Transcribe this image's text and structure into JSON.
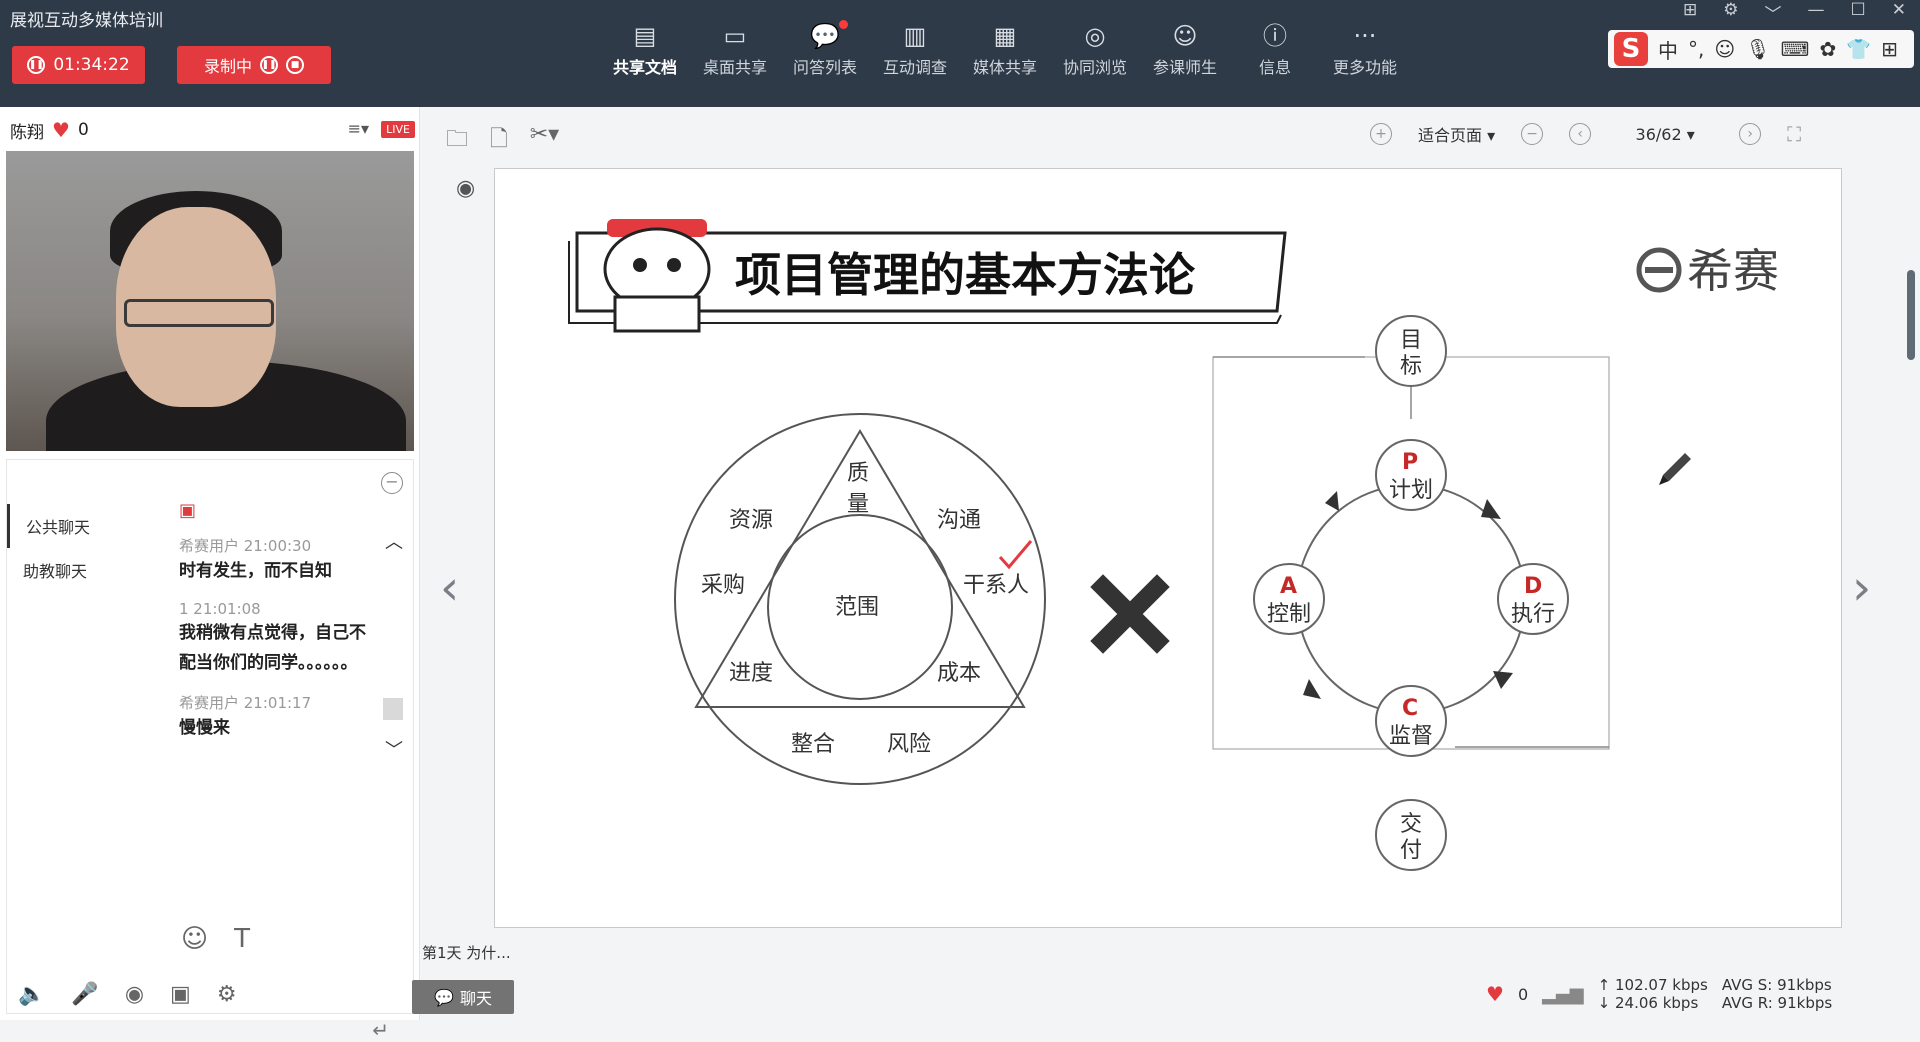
{
  "app": {
    "title": "展视互动多媒体培训"
  },
  "session": {
    "timer": "01:34:22",
    "recording_label": "录制中"
  },
  "toolbar": {
    "items": [
      {
        "label": "共享文档",
        "icon": "document-icon"
      },
      {
        "label": "桌面共享",
        "icon": "screen-share-icon"
      },
      {
        "label": "问答列表",
        "icon": "chat-bubble-icon"
      },
      {
        "label": "互动调查",
        "icon": "bar-chart-icon"
      },
      {
        "label": "媒体共享",
        "icon": "film-icon"
      },
      {
        "label": "协同浏览",
        "icon": "compass-icon"
      },
      {
        "label": "参课师生",
        "icon": "users-icon"
      },
      {
        "label": "信息",
        "icon": "info-icon"
      },
      {
        "label": "更多功能",
        "icon": "more-icon"
      }
    ]
  },
  "ime": {
    "logo": "S",
    "lang": "中",
    "punct": "°,"
  },
  "host": {
    "name": "陈翔",
    "likes": "0",
    "live": "LIVE"
  },
  "chat": {
    "tabs": [
      "公共聊天",
      "助教聊天"
    ],
    "messages": [
      {
        "meta": "希赛用户 21:00:30",
        "text": "时有发生，而不自知"
      },
      {
        "meta": "1 21:01:08",
        "text": "我稍微有点觉得，自己不配当你们的同学。。。。。。"
      },
      {
        "meta": "希赛用户 21:01:17",
        "text": "慢慢来"
      }
    ]
  },
  "viewer": {
    "fit_label": "适合页面",
    "page": "36/62"
  },
  "slide": {
    "title": "项目管理的基本方法论",
    "brand": "希赛",
    "triangle": {
      "top": "质量",
      "center": "范围",
      "bottom_left": "进度",
      "bottom_right": "成本"
    },
    "ring": {
      "tl": "资源",
      "tr": "沟通",
      "ml": "采购",
      "mr": "干系人",
      "bl": "整合",
      "br": "风险"
    },
    "cycle": {
      "goal": "目标",
      "plan_letter": "P",
      "plan": "计划",
      "do_letter": "D",
      "do": "执行",
      "check_letter": "C",
      "check": "监督",
      "act_letter": "A",
      "act": "控制",
      "deliver": "交付"
    }
  },
  "footer": {
    "caption": "第1天  为什...",
    "chat_button": "聊天",
    "likes": "0",
    "up": "102.07 kbps",
    "down": "24.06 kbps",
    "avg_s": "AVG S: 91kbps",
    "avg_r": "AVG R: 91kbps"
  }
}
